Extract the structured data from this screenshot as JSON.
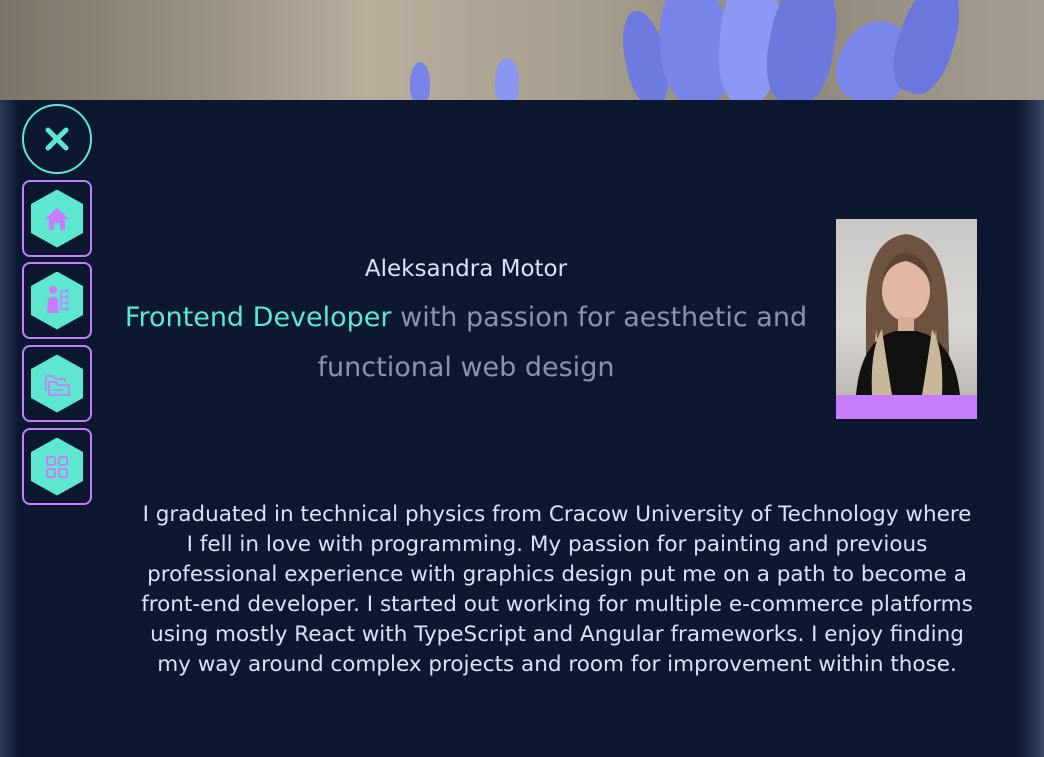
{
  "hero": {
    "image": "blue-flowers-photo"
  },
  "nav": {
    "close_icon": "close-icon",
    "items": [
      {
        "icon": "home-icon"
      },
      {
        "icon": "person-skills-icon"
      },
      {
        "icon": "folders-icon"
      },
      {
        "icon": "apps-grid-icon"
      }
    ]
  },
  "profile": {
    "name": "Aleksandra Motor",
    "role": "Frontend Developer",
    "tagline": "with passion for aesthetic and functional web design",
    "bio": "I graduated in technical physics from Cracow University of Technology where I fell in love with programming. My passion for painting and previous professional experience with graphics design put me on a path to become a front-end developer. I started out working for multiple e-commerce platforms using mostly React with TypeScript and Angular frameworks. I enjoy finding my way around complex projects and room for improvement within those.",
    "photo": "profile-photo"
  },
  "colors": {
    "accent_teal": "#5ee7cf",
    "accent_purple": "#c77dff",
    "background": "#0b1830",
    "text_light": "#d9e3f5",
    "text_muted": "#8894ad"
  }
}
